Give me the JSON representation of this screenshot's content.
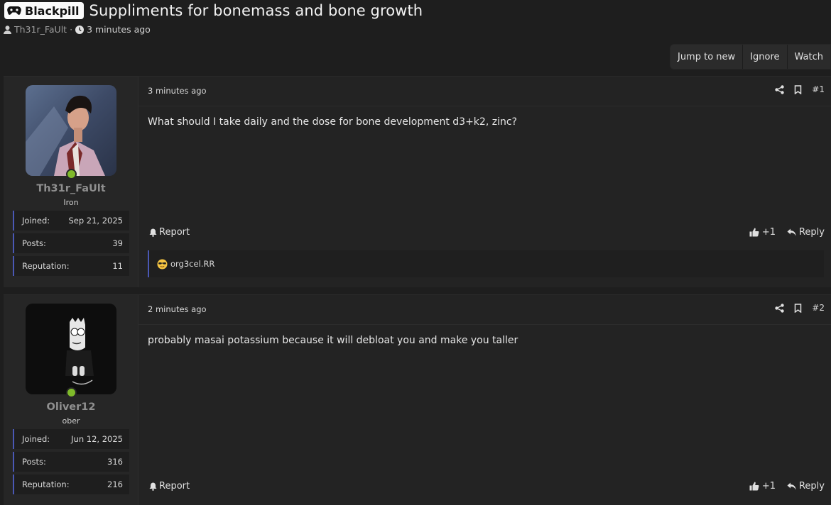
{
  "thread": {
    "prefix": "Blackpill",
    "title": "Suppliments for bonemass and bone growth",
    "author": "Th31r_FaUlt",
    "separator": "·",
    "time": "3 minutes ago"
  },
  "actions": {
    "jump_to_new": "Jump to new",
    "ignore": "Ignore",
    "watch": "Watch"
  },
  "posts": [
    {
      "date": "3 minutes ago",
      "number": "#1",
      "body": "What should I take daily and the dose for bone development d3+k2, zinc?",
      "report": "Report",
      "likes": "+1",
      "reply": "Reply",
      "reaction_user": "org3cel.RR",
      "user": {
        "name": "Th31r_FaUlt",
        "title": "Iron",
        "joined_label": "Joined:",
        "joined": "Sep 21, 2025",
        "posts_label": "Posts:",
        "posts": "39",
        "reputation_label": "Reputation:",
        "reputation": "11"
      }
    },
    {
      "date": "2 minutes ago",
      "number": "#2",
      "body": "probably masai potassium because it will debloat you and make you taller",
      "report": "Report",
      "likes": "+1",
      "reply": "Reply",
      "user": {
        "name": "Oliver12",
        "title": "ober",
        "joined_label": "Joined:",
        "joined": "Jun 12, 2025",
        "posts_label": "Posts:",
        "posts": "316",
        "reputation_label": "Reputation:",
        "reputation": "216"
      }
    }
  ],
  "colors": {
    "background": "#1e1e1e",
    "online": "#7fba2a",
    "accent_border": "#4a58b5"
  },
  "icons": {
    "prefix": "gamepad-icon",
    "author": "user-icon",
    "time": "clock-icon",
    "share": "share-icon",
    "bookmark": "bookmark-icon",
    "report": "bell-icon",
    "like": "thumbs-up-icon",
    "reply": "reply-icon",
    "reaction": "sunglasses-emoji-icon"
  }
}
